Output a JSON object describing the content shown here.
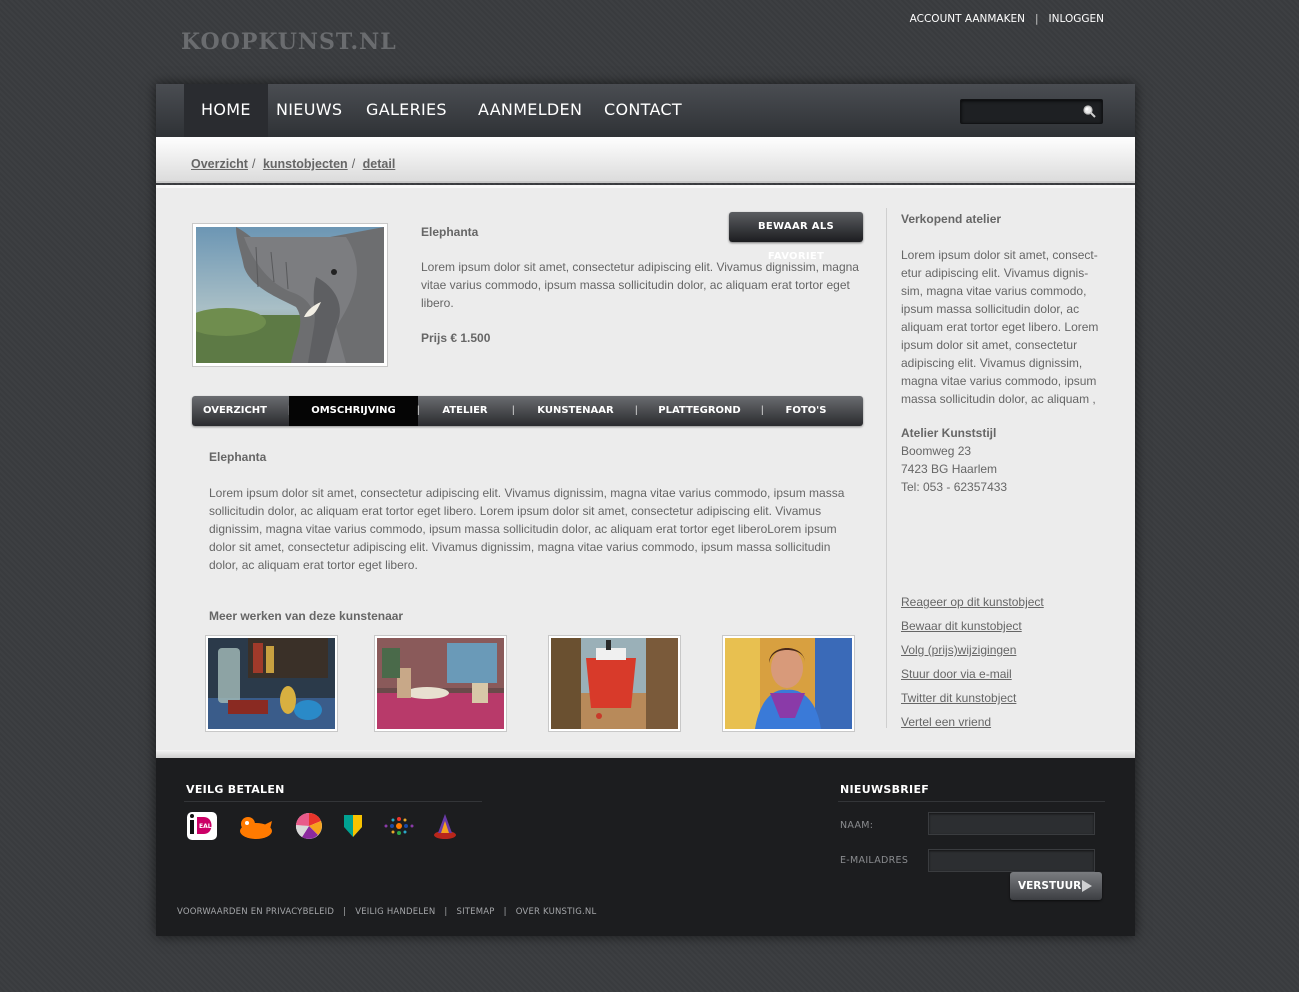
{
  "site": {
    "logo": "KOOPKUNST.NL",
    "top_links": [
      "ACCOUNT AANMAKEN",
      "INLOGGEN"
    ]
  },
  "nav": {
    "items": [
      "HOME",
      "NIEUWS",
      "GALERIES",
      "AANMELDEN",
      "CONTACT"
    ],
    "active": "HOME",
    "search_value": ""
  },
  "breadcrumb": [
    "Overzicht",
    "kunstobjecten",
    "detail"
  ],
  "artwork": {
    "title": "Elephanta",
    "description": "Lorem ipsum dolor sit amet, consectetur adipiscing elit. Vivamus dignissim, magna vitae varius commodo, ipsum massa sollicitudin dolor, ac aliquam erat tortor eget libero.",
    "price": "Prijs € 1.500",
    "favorite_button": "BEWAAR ALS FAVORIET"
  },
  "tabs": {
    "items": [
      "OVERZICHT",
      "OMSCHRIJVING",
      "ATELIER",
      "KUNSTENAAR",
      "PLATTEGROND",
      "FOTO'S"
    ],
    "active": "OMSCHRIJVING",
    "content_title": "Elephanta",
    "content_text": "Lorem ipsum dolor sit amet, consectetur adipiscing elit. Vivamus dignissim, magna vitae varius commodo, ipsum massa sollicitudin dolor, ac aliquam erat tortor eget libero. Lorem ipsum dolor sit amet, consectetur adipiscing elit. Vivamus dignissim, magna vitae varius commodo, ipsum massa sollicitudin dolor, ac aliquam erat tortor eget liberoLorem ipsum dolor sit amet, consectetur adipiscing elit. Vivamus dignissim, magna vitae varius commodo, ipsum massa sollicitudin dolor, ac aliquam erat tortor eget libero."
  },
  "more_works": {
    "title": "Meer werken van deze kunstenaar"
  },
  "sidebar": {
    "heading": "Verkopend atelier",
    "text": "Lorem ipsum dolor sit amet, consect-etur adipiscing elit. Vivamus dignis-sim, magna vitae varius commodo, ipsum massa sollicitudin dolor, ac aliquam erat tortor eget libero. Lorem ipsum dolor sit amet, consectetur adipiscing elit. Vivamus dignissim, magna vitae varius commodo, ipsum massa sollicitudin dolor, ac aliquam ,",
    "atelier_name": "Atelier Kunststijl",
    "address": "Boomweg 23",
    "city": "7423 BG Haarlem",
    "phone": "Tel: 053 - 62357433",
    "links": [
      "Reageer op dit kunstobject",
      "Bewaar dit kunstobject",
      "Volg (prijs)wijzigingen",
      "Stuur door via e-mail",
      "Twitter dit kunstobject",
      "Vertel een vriend"
    ]
  },
  "footer": {
    "payment_title": "VEILG BETALEN",
    "payment_icons": [
      "ideal-icon",
      "ing-lion-icon",
      "abn-wheel-icon",
      "abn-shield-icon",
      "rabobank-dots-icon",
      "sns-icon"
    ],
    "newsletter_title": "NIEUWSBRIEF",
    "name_label": "NAAM:",
    "email_label": "E-MAILADRES",
    "name_value": "",
    "email_value": "",
    "send_button": "VERSTUUR",
    "links": [
      "VOORWAARDEN EN PRIVACYBELEID",
      "VEILIG HANDELEN",
      "SITEMAP",
      "OVER KUNSTIG.NL"
    ]
  },
  "colors": {
    "background": "#3a3c3f",
    "content": "#ececec",
    "footer": "#1c1d1f",
    "text": "#666666"
  }
}
